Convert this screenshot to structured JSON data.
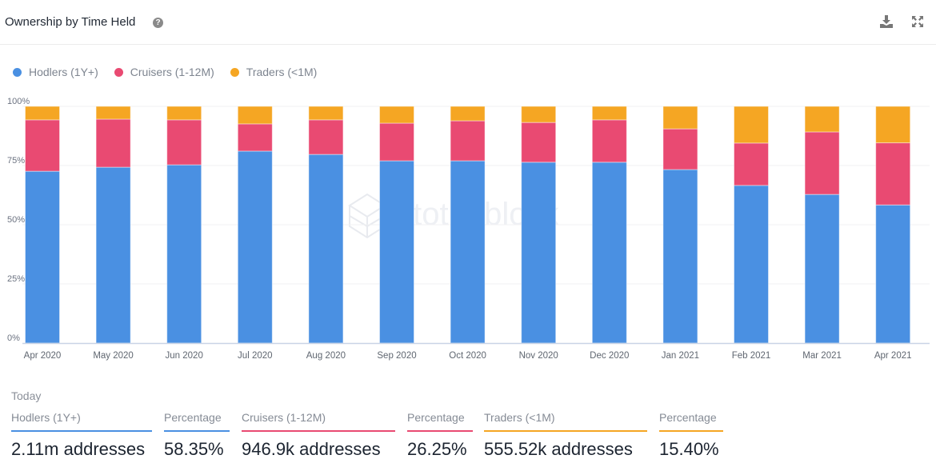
{
  "header": {
    "title": "Ownership by Time Held",
    "help_icon": "question-circle-icon",
    "download_icon": "download-icon",
    "expand_icon": "expand-icon"
  },
  "colors": {
    "hodlers": "#4a90e2",
    "cruisers": "#e94a72",
    "traders": "#f5a623"
  },
  "legend": [
    {
      "label": "Hodlers (1Y+)",
      "color": "#4a90e2"
    },
    {
      "label": "Cruisers (1-12M)",
      "color": "#e94a72"
    },
    {
      "label": "Traders (<1M)",
      "color": "#f5a623"
    }
  ],
  "watermark": "intotheblock",
  "chart_data": {
    "type": "bar",
    "stacked": true,
    "title": "Ownership by Time Held",
    "xlabel": "",
    "ylabel": "",
    "ylim": [
      0,
      100
    ],
    "yticks": [
      "0%",
      "25%",
      "50%",
      "75%",
      "100%"
    ],
    "grid": true,
    "legend_position": "top-left",
    "categories": [
      "Apr 2020",
      "May 2020",
      "Jun 2020",
      "Jul 2020",
      "Aug 2020",
      "Sep 2020",
      "Oct 2020",
      "Nov 2020",
      "Dec 2020",
      "Jan 2021",
      "Feb 2021",
      "Mar 2021",
      "Apr 2021"
    ],
    "series": [
      {
        "name": "Hodlers (1Y+)",
        "color": "#4a90e2",
        "values": [
          72.6,
          74.3,
          75.3,
          81.1,
          79.7,
          77.0,
          77.0,
          76.4,
          76.4,
          73.3,
          66.6,
          62.8,
          58.35
        ]
      },
      {
        "name": "Cruisers (1-12M)",
        "color": "#e94a72",
        "values": [
          21.7,
          20.3,
          19.0,
          11.5,
          14.6,
          15.9,
          16.9,
          16.8,
          17.9,
          17.2,
          17.9,
          26.4,
          26.25
        ]
      },
      {
        "name": "Traders (<1M)",
        "color": "#f5a623",
        "values": [
          5.7,
          5.4,
          5.7,
          7.4,
          5.7,
          7.1,
          6.1,
          6.8,
          5.7,
          9.5,
          15.5,
          10.8,
          15.4
        ]
      }
    ]
  },
  "today": {
    "label": "Today",
    "stats": [
      {
        "label": "Hodlers (1Y+)",
        "value": "2.11m addresses",
        "color": "#4a90e2"
      },
      {
        "label": "Percentage",
        "value": "58.35%",
        "color": "#4a90e2"
      },
      {
        "label": "Cruisers (1-12M)",
        "value": "946.9k addresses",
        "color": "#e94a72"
      },
      {
        "label": "Percentage",
        "value": "26.25%",
        "color": "#e94a72"
      },
      {
        "label": "Traders (<1M)",
        "value": "555.52k addresses",
        "color": "#f5a623"
      },
      {
        "label": "Percentage",
        "value": "15.40%",
        "color": "#f5a623"
      }
    ]
  }
}
